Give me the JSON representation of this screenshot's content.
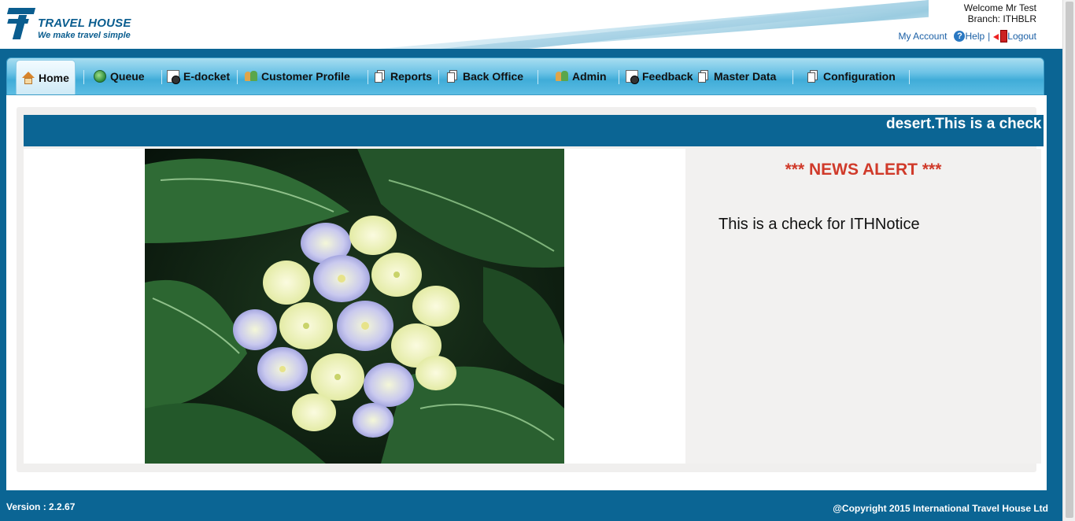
{
  "header": {
    "brand_name": "TRAVEL HOUSE",
    "tagline": "We make travel simple",
    "welcome_text": "Welcome Mr Test",
    "branch_text": "Branch: ITHBLR",
    "my_account_label": "My Account",
    "help_label": "Help",
    "separator": "|",
    "logout_label": "Logout"
  },
  "nav": {
    "items": [
      {
        "label": "Home",
        "icon": "home-icon",
        "active": true
      },
      {
        "label": "Queue",
        "icon": "globe-icon"
      },
      {
        "label": "E-docket",
        "icon": "document-icon"
      },
      {
        "label": "Customer Profile",
        "icon": "people-icon"
      },
      {
        "label": "Reports",
        "icon": "pages-icon"
      },
      {
        "label": "Back Office",
        "icon": "pages-icon"
      },
      {
        "label": "Admin",
        "icon": "people-icon"
      },
      {
        "label": "Feedback",
        "icon": "document-icon"
      },
      {
        "label": "Master Data",
        "icon": "pages-icon"
      },
      {
        "label": "Configuration",
        "icon": "pages-icon"
      }
    ]
  },
  "marquee": {
    "text": "desert.This is a check"
  },
  "news": {
    "title": "*** NEWS ALERT ***",
    "body": "This is a check for ITHNotice"
  },
  "footer": {
    "version": "Version : 2.2.67",
    "copyright": "@Copyright 2015 International Travel House Ltd"
  },
  "colors": {
    "primary_blue": "#0b6594",
    "news_red": "#d03a2a",
    "link_blue": "#1a5fa5"
  }
}
